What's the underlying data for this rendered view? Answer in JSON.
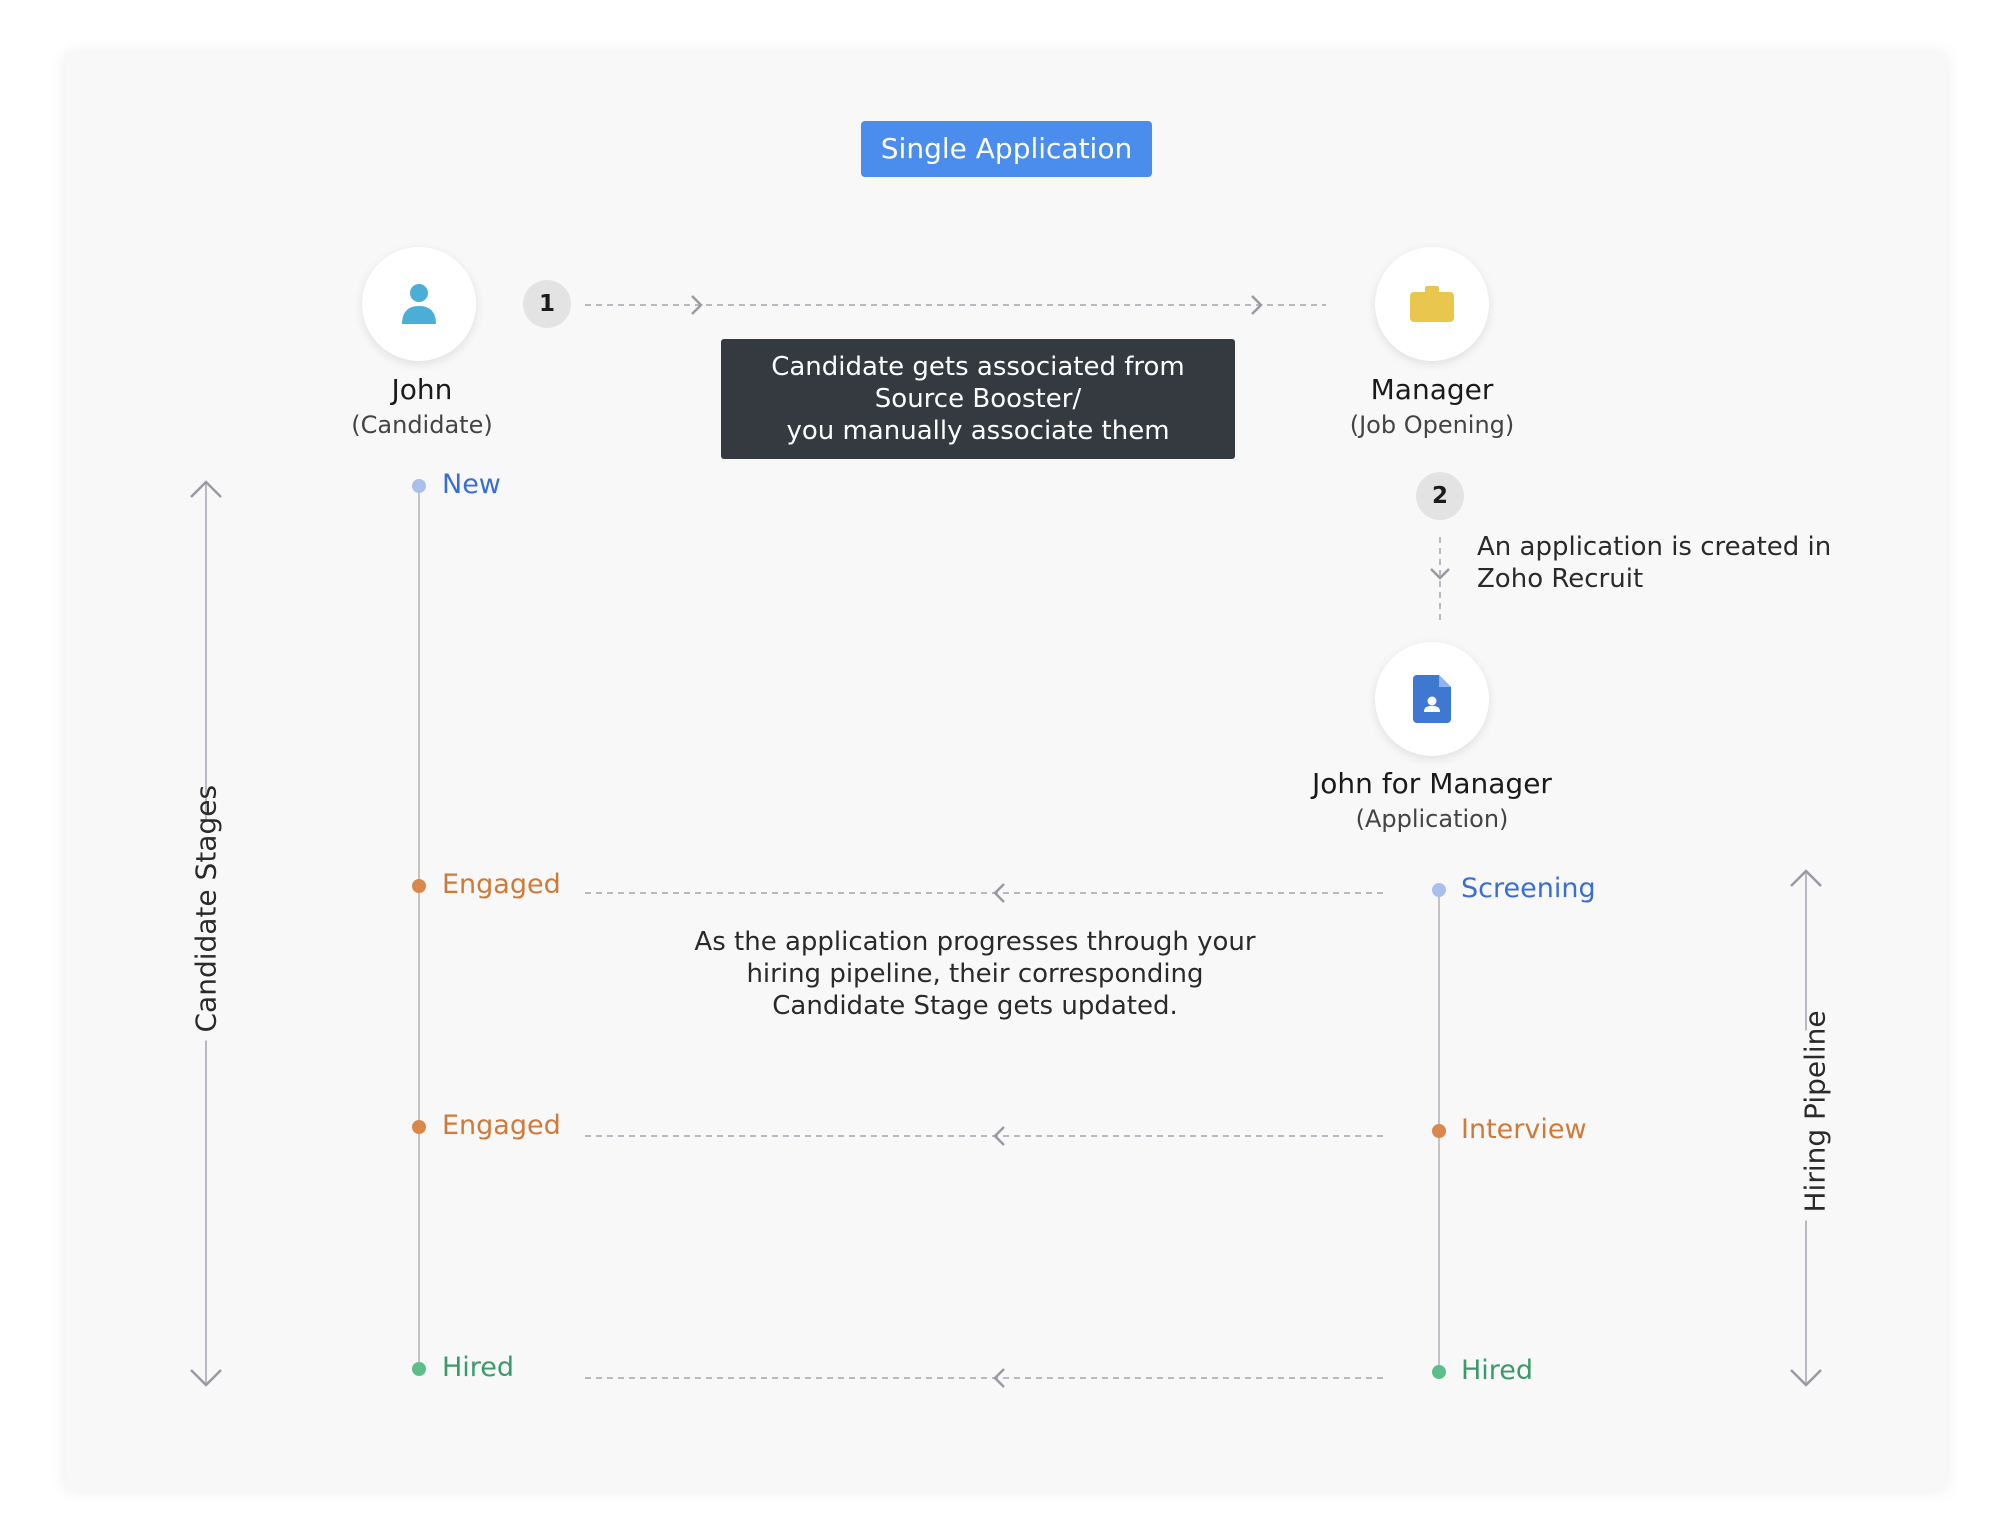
{
  "title": "Single Application",
  "candidate": {
    "name": "John",
    "role": "(Candidate)",
    "icon": "person-icon"
  },
  "job_opening": {
    "name": "Manager",
    "role": "(Job Opening)",
    "icon": "briefcase-icon"
  },
  "application": {
    "name": "John for Manager",
    "role": "(Application)",
    "icon": "document-person-icon"
  },
  "step1": {
    "number": "1",
    "lines": [
      "Candidate gets associated from",
      "Source Booster/",
      "you manually associate them"
    ]
  },
  "step2": {
    "number": "2",
    "lines": [
      "An application is created in",
      "Zoho Recruit"
    ]
  },
  "progress_note": {
    "lines": [
      "As the application progresses through your",
      "hiring pipeline, their corresponding",
      "Candidate Stage gets updated."
    ]
  },
  "candidate_stages": {
    "label": "Candidate Stages",
    "items": [
      {
        "label": "New",
        "color": "#3a6fd0",
        "dot": "#a9c1ea"
      },
      {
        "label": "Engaged",
        "color": "#d07a3a",
        "dot": "#d9874a"
      },
      {
        "label": "Engaged",
        "color": "#d07a3a",
        "dot": "#d9874a"
      },
      {
        "label": "Hired",
        "color": "#3a9a6a",
        "dot": "#5cbf8a"
      }
    ]
  },
  "hiring_pipeline": {
    "label": "Hiring Pipeline",
    "items": [
      {
        "label": "Screening",
        "color": "#3a6fd0",
        "dot": "#a9c1ea"
      },
      {
        "label": "Interview",
        "color": "#d07a3a",
        "dot": "#d9874a"
      },
      {
        "label": "Hired",
        "color": "#3a9a6a",
        "dot": "#5cbf8a"
      }
    ]
  },
  "colors": {
    "badge": "#4a8ded",
    "tooltip_bg": "#343a40",
    "person_icon": "#4aaed6",
    "briefcase_icon": "#e9c64e",
    "document_icon": "#3f78d0",
    "connector": "#b9b9c2"
  }
}
